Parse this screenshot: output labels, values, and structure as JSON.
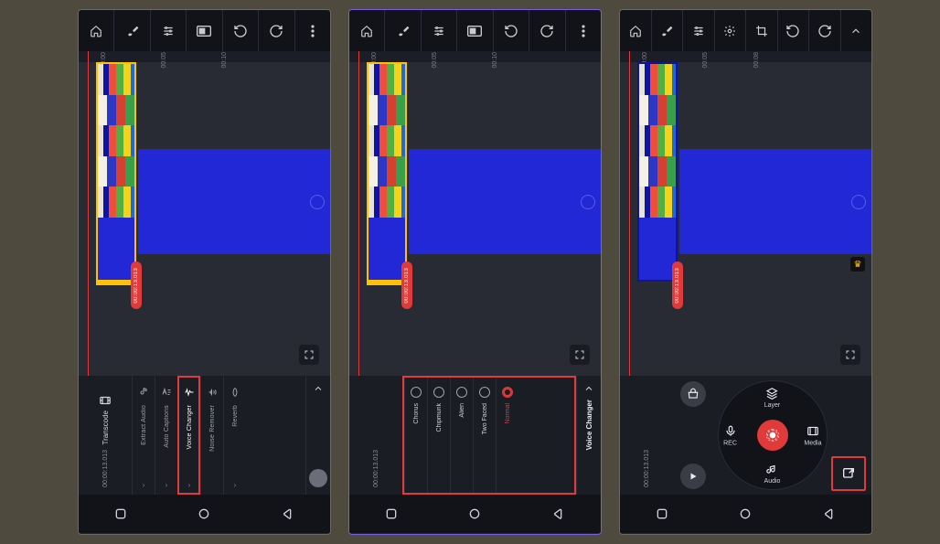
{
  "toolbar": {
    "icons_editing": [
      "home",
      "brush",
      "sliders",
      "aspect",
      "undo",
      "redo",
      "more"
    ],
    "icons_main": [
      "home",
      "brush",
      "sliders",
      "gear",
      "crop",
      "undo",
      "redo",
      "up"
    ]
  },
  "timeline": {
    "ticks": [
      "00:00",
      "00:05",
      "00:10"
    ],
    "tick_s3": "00:08",
    "playhead_time": "00:10",
    "playhead_pill": "00:00:13.013",
    "timecode": "00:00:13.013",
    "transcode_label": "Transcode"
  },
  "tools": [
    {
      "id": "extract-audio",
      "label": "Extract Audio"
    },
    {
      "id": "auto-captions",
      "label": "Auto Captions"
    },
    {
      "id": "voice-changer",
      "label": "Voice Changer",
      "active": true
    },
    {
      "id": "noise-remover",
      "label": "Noise Remover"
    },
    {
      "id": "reverb",
      "label": "Reverb"
    }
  ],
  "voice_changer": {
    "title": "Voice Changer",
    "options": [
      {
        "id": "chorus",
        "label": "Chorus"
      },
      {
        "id": "chipmunk",
        "label": "Chipmunk"
      },
      {
        "id": "alien",
        "label": "Alien"
      },
      {
        "id": "two-faced",
        "label": "Two Faced"
      },
      {
        "id": "normal",
        "label": "Normal",
        "selected": true
      }
    ]
  },
  "wheel": {
    "top": "Layer",
    "right": "Media",
    "bottom": "Audio",
    "left": "REC"
  },
  "nav": {
    "back": "back",
    "home": "home",
    "recents": "recents"
  }
}
